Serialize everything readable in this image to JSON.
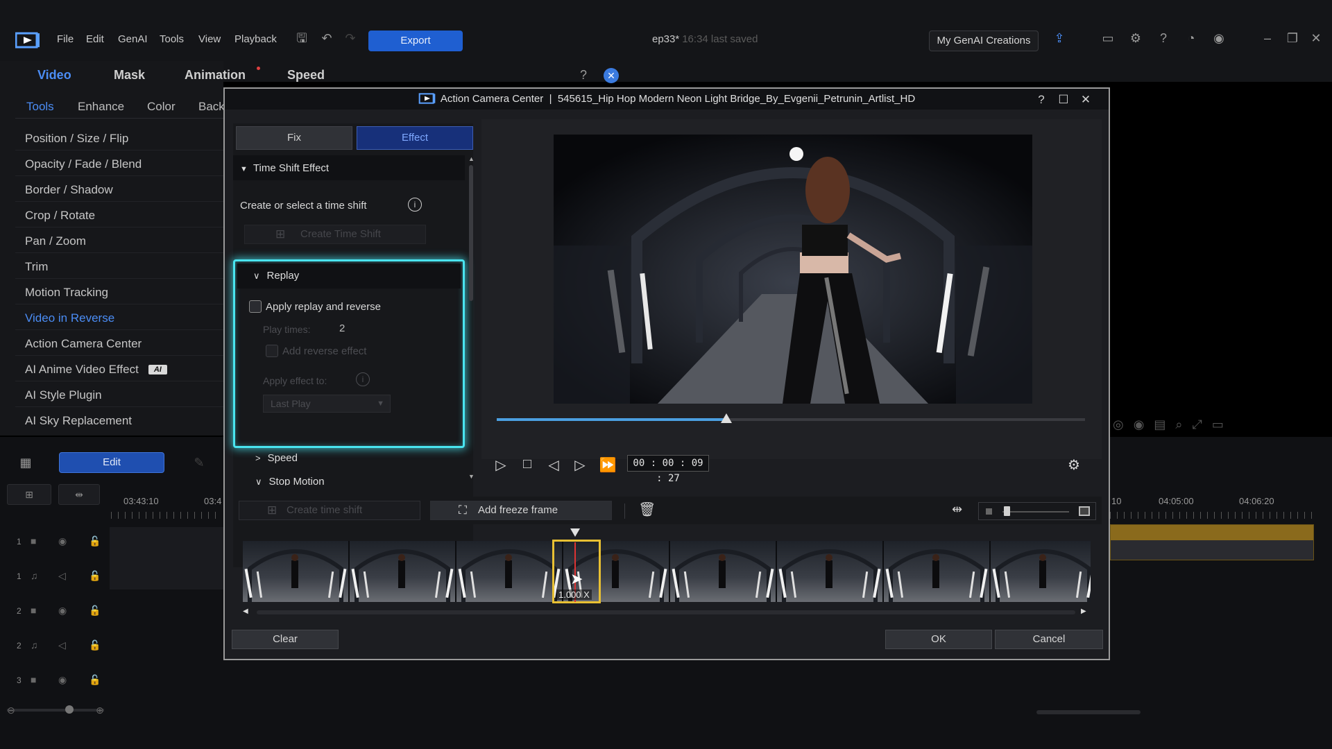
{
  "app": {
    "menu": [
      "File",
      "Edit",
      "GenAI",
      "Tools",
      "View",
      "Playback"
    ],
    "export_label": "Export",
    "doc_name": "ep33*",
    "doc_saved": "16:34 last saved",
    "genai_creations_label": "My GenAI Creations"
  },
  "left_panel": {
    "main_tabs": [
      "Video",
      "Mask",
      "Animation",
      "Speed"
    ],
    "sub_tabs": [
      "Tools",
      "Enhance",
      "Color",
      "Back"
    ],
    "tools": [
      "Position / Size / Flip",
      "Opacity / Fade / Blend",
      "Border / Shadow",
      "Crop / Rotate",
      "Pan / Zoom",
      "Trim",
      "Motion Tracking",
      "Video in Reverse",
      "Action Camera Center",
      "AI Anime Video Effect",
      "AI Style Plugin",
      "AI Sky Replacement"
    ],
    "ai_badge": "AI",
    "active_tool_index": 7
  },
  "timeline": {
    "edit_label": "Edit",
    "ruler_labels": [
      "03:43:10",
      "03:4",
      "10",
      "04:05:00",
      "04:06:20"
    ],
    "track_numbers": [
      "1",
      "1",
      "2",
      "2",
      "3"
    ]
  },
  "dialog": {
    "app_name": "Action Camera Center",
    "separator": "|",
    "clip_name": "545615_Hip Hop Modern Neon Light Bridge_By_Evgenii_Petrunin_Artlist_HD",
    "tabs": {
      "fix": "Fix",
      "effect": "Effect"
    },
    "time_shift": {
      "header": "Time Shift Effect",
      "prompt": "Create or select a time shift",
      "create_btn": "Create Time Shift"
    },
    "replay": {
      "header": "Replay",
      "apply_label": "Apply replay and reverse",
      "play_times_label": "Play times:",
      "play_times_value": "2",
      "add_reverse_label": "Add reverse effect",
      "apply_effect_to_label": "Apply effect to:",
      "apply_effect_to_value": "Last Play"
    },
    "speed_header": "Speed",
    "stop_motion_header": "Stop Motion",
    "playback": {
      "timecode": "00 : 00 : 09 : 27",
      "progress": 0.39
    },
    "toolbar": {
      "create_time_shift": "Create time shift",
      "add_freeze_frame": "Add freeze frame"
    },
    "filmstrip": {
      "speed_label": "1.000 X"
    },
    "footer": {
      "clear": "Clear",
      "ok": "OK",
      "cancel": "Cancel"
    }
  },
  "colors": {
    "accent_blue": "#1f5fd1",
    "highlight_cyan": "#49e4ef",
    "selection_yellow": "#e8c033"
  }
}
